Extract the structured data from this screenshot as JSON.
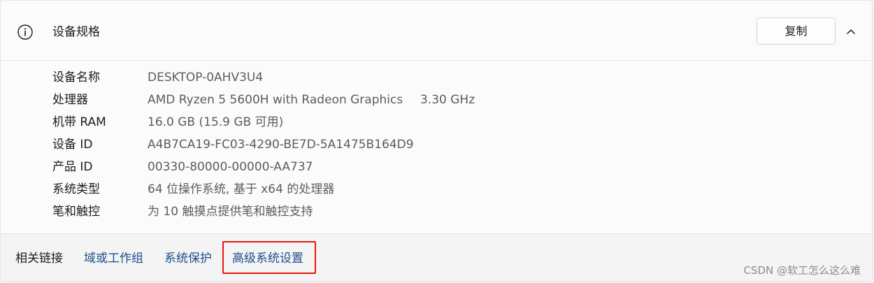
{
  "header": {
    "title": "设备规格",
    "copy_label": "复制",
    "info_icon": "info-icon",
    "chevron_icon": "chevron-up-icon"
  },
  "specs": [
    {
      "label": "设备名称",
      "value": "DESKTOP-0AHV3U4",
      "extra": ""
    },
    {
      "label": "处理器",
      "value": "AMD Ryzen 5 5600H with Radeon Graphics",
      "extra": "3.30 GHz"
    },
    {
      "label": "机带 RAM",
      "value": "16.0 GB (15.9 GB 可用)",
      "extra": ""
    },
    {
      "label": "设备 ID",
      "value": "A4B7CA19-FC03-4290-BE7D-5A1475B164D9",
      "extra": ""
    },
    {
      "label": "产品 ID",
      "value": "00330-80000-00000-AA737",
      "extra": ""
    },
    {
      "label": "系统类型",
      "value": "64 位操作系统, 基于 x64 的处理器",
      "extra": ""
    },
    {
      "label": "笔和触控",
      "value": "为 10 触摸点提供笔和触控支持",
      "extra": ""
    }
  ],
  "footer": {
    "label": "相关链接",
    "links": [
      "域或工作组",
      "系统保护",
      "高级系统设置"
    ]
  },
  "watermark": "CSDN @软工怎么这么难",
  "colors": {
    "link": "#1a4f8a",
    "highlight_box": "#e8160d"
  }
}
